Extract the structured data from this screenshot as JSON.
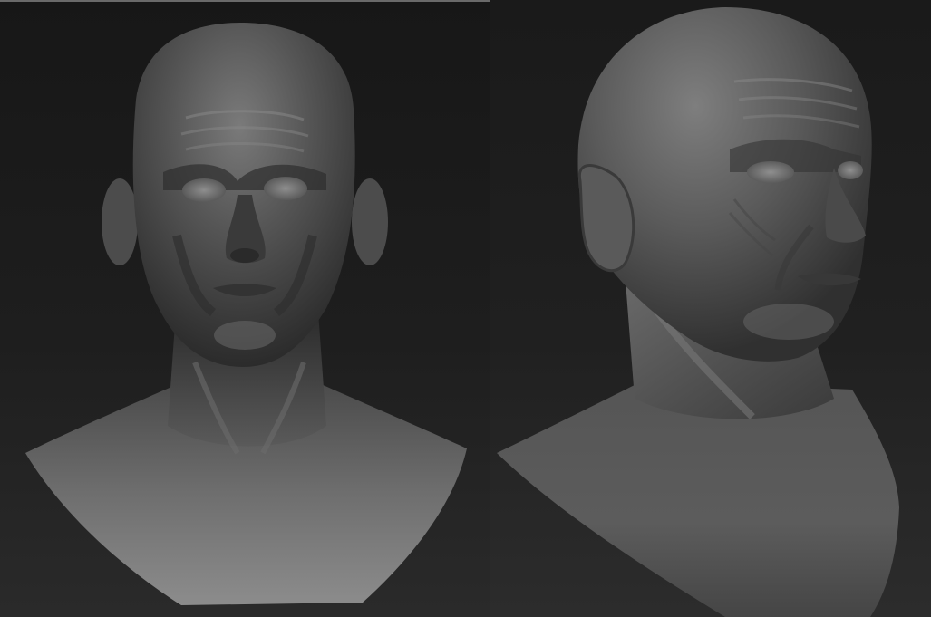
{
  "scene": {
    "views": [
      {
        "id": "front",
        "subject": "sculpted-male-bust"
      },
      {
        "id": "three-quarter",
        "subject": "sculpted-male-bust"
      }
    ],
    "colors": {
      "background_top": "#171717",
      "background_bottom": "#2a2a2a",
      "clay_light": "#8a8a8a",
      "clay_mid": "#5e5e5e",
      "clay_dark": "#2c2c2c"
    }
  }
}
